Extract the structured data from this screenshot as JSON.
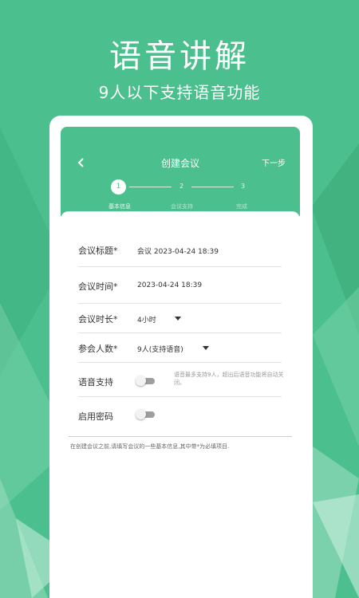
{
  "promo": {
    "title": "语音讲解",
    "subtitle": "9人以下支持语音功能"
  },
  "header": {
    "title": "创建会议",
    "next_label": "下一步",
    "back_icon": "chevron-left-icon"
  },
  "steps": [
    {
      "number": "1",
      "label": "基本信息",
      "active": true
    },
    {
      "number": "2",
      "label": "会议支持",
      "active": false
    },
    {
      "number": "3",
      "label": "完成",
      "active": false
    }
  ],
  "form": {
    "title_label": "会议标题*",
    "title_value": "会议 2023-04-24 18:39",
    "time_label": "会议时间*",
    "time_value": "2023-04-24 18:39",
    "duration_label": "会议时长*",
    "duration_value": "4小时",
    "attendees_label": "参会人数*",
    "attendees_value": "9人(支持语音)",
    "voice_label": "语音支持",
    "voice_hint": "语音最多支持9人，超出后语音功能将自动关闭。",
    "password_label": "启用密码"
  },
  "footer_note": "在创建会议之前,请填写会议的一些基本信息,其中带*为必填项目.",
  "colors": {
    "brand_green": "#4cbf8e",
    "toggle_off": "#9e9e9e"
  }
}
